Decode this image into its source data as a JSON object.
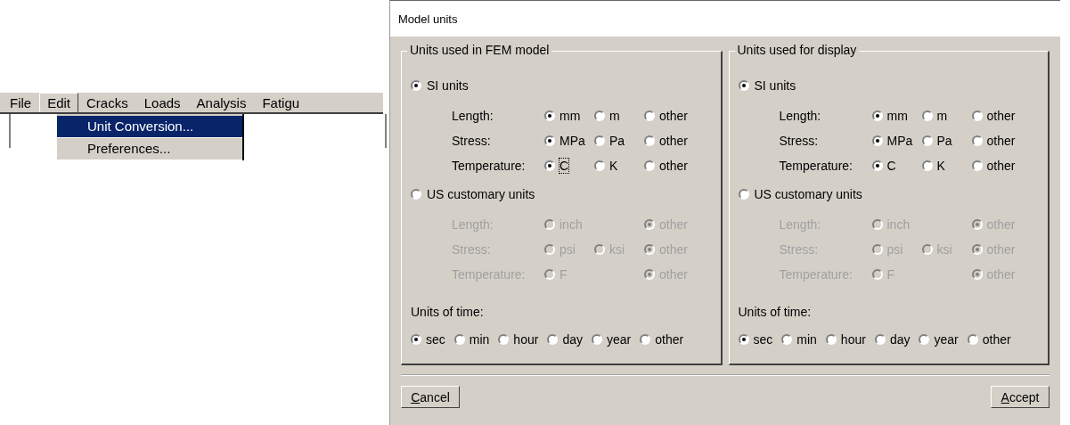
{
  "menu_bar": {
    "items": [
      {
        "label": "File",
        "selected": false
      },
      {
        "label": "Edit",
        "selected": true
      },
      {
        "label": "Cracks",
        "selected": false
      },
      {
        "label": "Loads",
        "selected": false
      },
      {
        "label": "Analysis",
        "selected": false
      },
      {
        "label": "Fatigu",
        "selected": false
      }
    ]
  },
  "dropdown": {
    "items": [
      {
        "label": "Unit Conversion...",
        "selected": true
      },
      {
        "label": "Preferences...",
        "selected": false
      }
    ]
  },
  "dialog": {
    "title": "Model units",
    "panels": [
      {
        "title": "Units used in FEM model",
        "systems": [
          {
            "label": "SI units",
            "selected": true,
            "rows": [
              {
                "label": "Length:",
                "disabled": false,
                "options": [
                  {
                    "label": "mm",
                    "selected": true,
                    "focused": false
                  },
                  {
                    "label": "m",
                    "selected": false,
                    "focused": false
                  },
                  {
                    "label": "other",
                    "selected": false,
                    "focused": false
                  }
                ]
              },
              {
                "label": "Stress:",
                "disabled": false,
                "options": [
                  {
                    "label": "MPa",
                    "selected": true,
                    "focused": false
                  },
                  {
                    "label": "Pa",
                    "selected": false,
                    "focused": false
                  },
                  {
                    "label": "other",
                    "selected": false,
                    "focused": false
                  }
                ]
              },
              {
                "label": "Temperature:",
                "disabled": false,
                "options": [
                  {
                    "label": "C",
                    "selected": true,
                    "focused": true
                  },
                  {
                    "label": "K",
                    "selected": false,
                    "focused": false
                  },
                  {
                    "label": "other",
                    "selected": false,
                    "focused": false
                  }
                ]
              }
            ]
          },
          {
            "label": "US customary units",
            "selected": false,
            "rows": [
              {
                "label": "Length:",
                "disabled": true,
                "options": [
                  {
                    "label": "inch",
                    "selected": false,
                    "focused": false
                  },
                  {
                    "label": "other",
                    "selected": true,
                    "focused": false
                  }
                ]
              },
              {
                "label": "Stress:",
                "disabled": true,
                "options": [
                  {
                    "label": "psi",
                    "selected": false,
                    "focused": false
                  },
                  {
                    "label": "ksi",
                    "selected": false,
                    "focused": false
                  },
                  {
                    "label": "other",
                    "selected": true,
                    "focused": false
                  }
                ]
              },
              {
                "label": "Temperature:",
                "disabled": true,
                "options": [
                  {
                    "label": "F",
                    "selected": false,
                    "focused": false
                  },
                  {
                    "label": "other",
                    "selected": true,
                    "focused": false
                  }
                ]
              }
            ]
          }
        ],
        "time": {
          "label": "Units of time:",
          "options": [
            {
              "label": "sec",
              "selected": true
            },
            {
              "label": "min",
              "selected": false
            },
            {
              "label": "hour",
              "selected": false
            },
            {
              "label": "day",
              "selected": false
            },
            {
              "label": "year",
              "selected": false
            },
            {
              "label": "other",
              "selected": false
            }
          ]
        }
      },
      {
        "title": "Units used for display",
        "systems": [
          {
            "label": "SI units",
            "selected": true,
            "rows": [
              {
                "label": "Length:",
                "disabled": false,
                "options": [
                  {
                    "label": "mm",
                    "selected": true,
                    "focused": false
                  },
                  {
                    "label": "m",
                    "selected": false,
                    "focused": false
                  },
                  {
                    "label": "other",
                    "selected": false,
                    "focused": false
                  }
                ]
              },
              {
                "label": "Stress:",
                "disabled": false,
                "options": [
                  {
                    "label": "MPa",
                    "selected": true,
                    "focused": false
                  },
                  {
                    "label": "Pa",
                    "selected": false,
                    "focused": false
                  },
                  {
                    "label": "other",
                    "selected": false,
                    "focused": false
                  }
                ]
              },
              {
                "label": "Temperature:",
                "disabled": false,
                "options": [
                  {
                    "label": "C",
                    "selected": true,
                    "focused": false
                  },
                  {
                    "label": "K",
                    "selected": false,
                    "focused": false
                  },
                  {
                    "label": "other",
                    "selected": false,
                    "focused": false
                  }
                ]
              }
            ]
          },
          {
            "label": "US customary units",
            "selected": false,
            "rows": [
              {
                "label": "Length:",
                "disabled": true,
                "options": [
                  {
                    "label": "inch",
                    "selected": false,
                    "focused": false
                  },
                  {
                    "label": "other",
                    "selected": true,
                    "focused": false
                  }
                ]
              },
              {
                "label": "Stress:",
                "disabled": true,
                "options": [
                  {
                    "label": "psi",
                    "selected": false,
                    "focused": false
                  },
                  {
                    "label": "ksi",
                    "selected": false,
                    "focused": false
                  },
                  {
                    "label": "other",
                    "selected": true,
                    "focused": false
                  }
                ]
              },
              {
                "label": "Temperature:",
                "disabled": true,
                "options": [
                  {
                    "label": "F",
                    "selected": false,
                    "focused": false
                  },
                  {
                    "label": "other",
                    "selected": true,
                    "focused": false
                  }
                ]
              }
            ]
          }
        ],
        "time": {
          "label": "Units of time:",
          "options": [
            {
              "label": "sec",
              "selected": true
            },
            {
              "label": "min",
              "selected": false
            },
            {
              "label": "hour",
              "selected": false
            },
            {
              "label": "day",
              "selected": false
            },
            {
              "label": "year",
              "selected": false
            },
            {
              "label": "other",
              "selected": false
            }
          ]
        }
      }
    ],
    "buttons": [
      {
        "label": "Cancel",
        "kind": "left"
      },
      {
        "label": "Accept",
        "kind": "right"
      }
    ]
  }
}
